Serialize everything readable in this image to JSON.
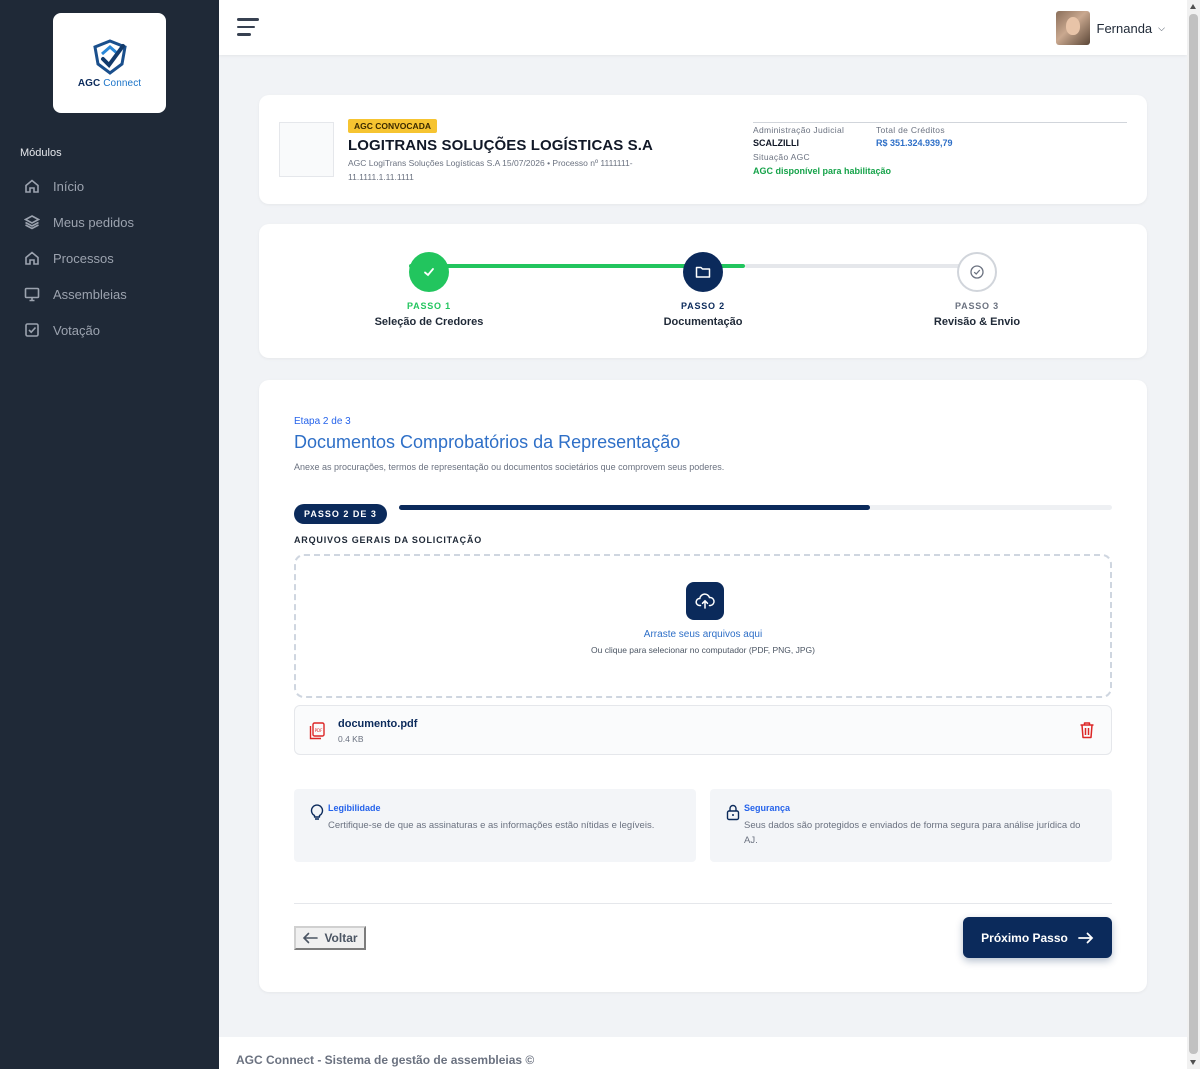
{
  "brand": {
    "name": "AGC",
    "suffix": "Connect",
    "logo_icon": "agc-shield-logo-icon"
  },
  "sidebar": {
    "section": "Módulos",
    "items": [
      {
        "label": "Início",
        "icon": "home-icon"
      },
      {
        "label": "Meus pedidos",
        "icon": "layers-icon"
      },
      {
        "label": "Processos",
        "icon": "home-icon"
      },
      {
        "label": "Assembleias",
        "icon": "monitor-icon"
      },
      {
        "label": "Votação",
        "icon": "checkbox-icon"
      }
    ]
  },
  "topbar": {
    "user_name": "Fernanda"
  },
  "header": {
    "badge": "AGC CONVOCADA",
    "company": "LOGITRANS SOLUÇÕES LOGÍSTICAS S.A",
    "subtitle": "AGC LogiTrans Soluções Logísticas S.A 15/07/2026 • Processo nº 1111111-11.1111.1.11.1111",
    "admin_label": "Administração Judicial",
    "admin_value": "SCALZILLI",
    "credits_label": "Total de Créditos",
    "credits_value": "R$ 351.324.939,79",
    "status_label": "Situação AGC",
    "status_value": "AGC disponível para habilitação"
  },
  "stepper": {
    "steps": [
      {
        "num": "PASSO 1",
        "label": "Seleção de Credores",
        "state": "done"
      },
      {
        "num": "PASSO 2",
        "label": "Documentação",
        "state": "active"
      },
      {
        "num": "PASSO 3",
        "label": "Revisão & Envio",
        "state": "pending"
      }
    ]
  },
  "main": {
    "etapa": "Etapa 2 de 3",
    "title": "Documentos Comprobatórios da Representação",
    "description": "Anexe as procurações, termos de representação ou documentos societários que comprovem seus poderes.",
    "pill": "PASSO 2 DE 3",
    "progress_fraction": 0.66,
    "section_label": "ARQUIVOS GERAIS DA SOLICITAÇÃO",
    "dropzone": {
      "title": "Arraste seus arquivos aqui",
      "subtitle": "Ou clique para selecionar no computador (PDF, PNG, JPG)"
    },
    "file": {
      "name": "documento.pdf",
      "size": "0.4 KB"
    },
    "tips": [
      {
        "title": "Legibilidade",
        "text": "Certifique-se de que as assinaturas e as informações estão nítidas e legíveis.",
        "icon": "lightbulb-icon"
      },
      {
        "title": "Segurança",
        "text": "Seus dados são protegidos e enviados de forma segura para análise jurídica do AJ.",
        "icon": "lock-icon"
      }
    ],
    "back_label": "Voltar",
    "next_label": "Próximo Passo"
  },
  "footer": {
    "text": "AGC Connect - Sistema de gestão de assembleias ©"
  },
  "colors": {
    "navy": "#0b2a5b",
    "green": "#22c55e",
    "blue": "#2e6fc7",
    "badge": "#f6c431",
    "danger": "#dc2626"
  }
}
